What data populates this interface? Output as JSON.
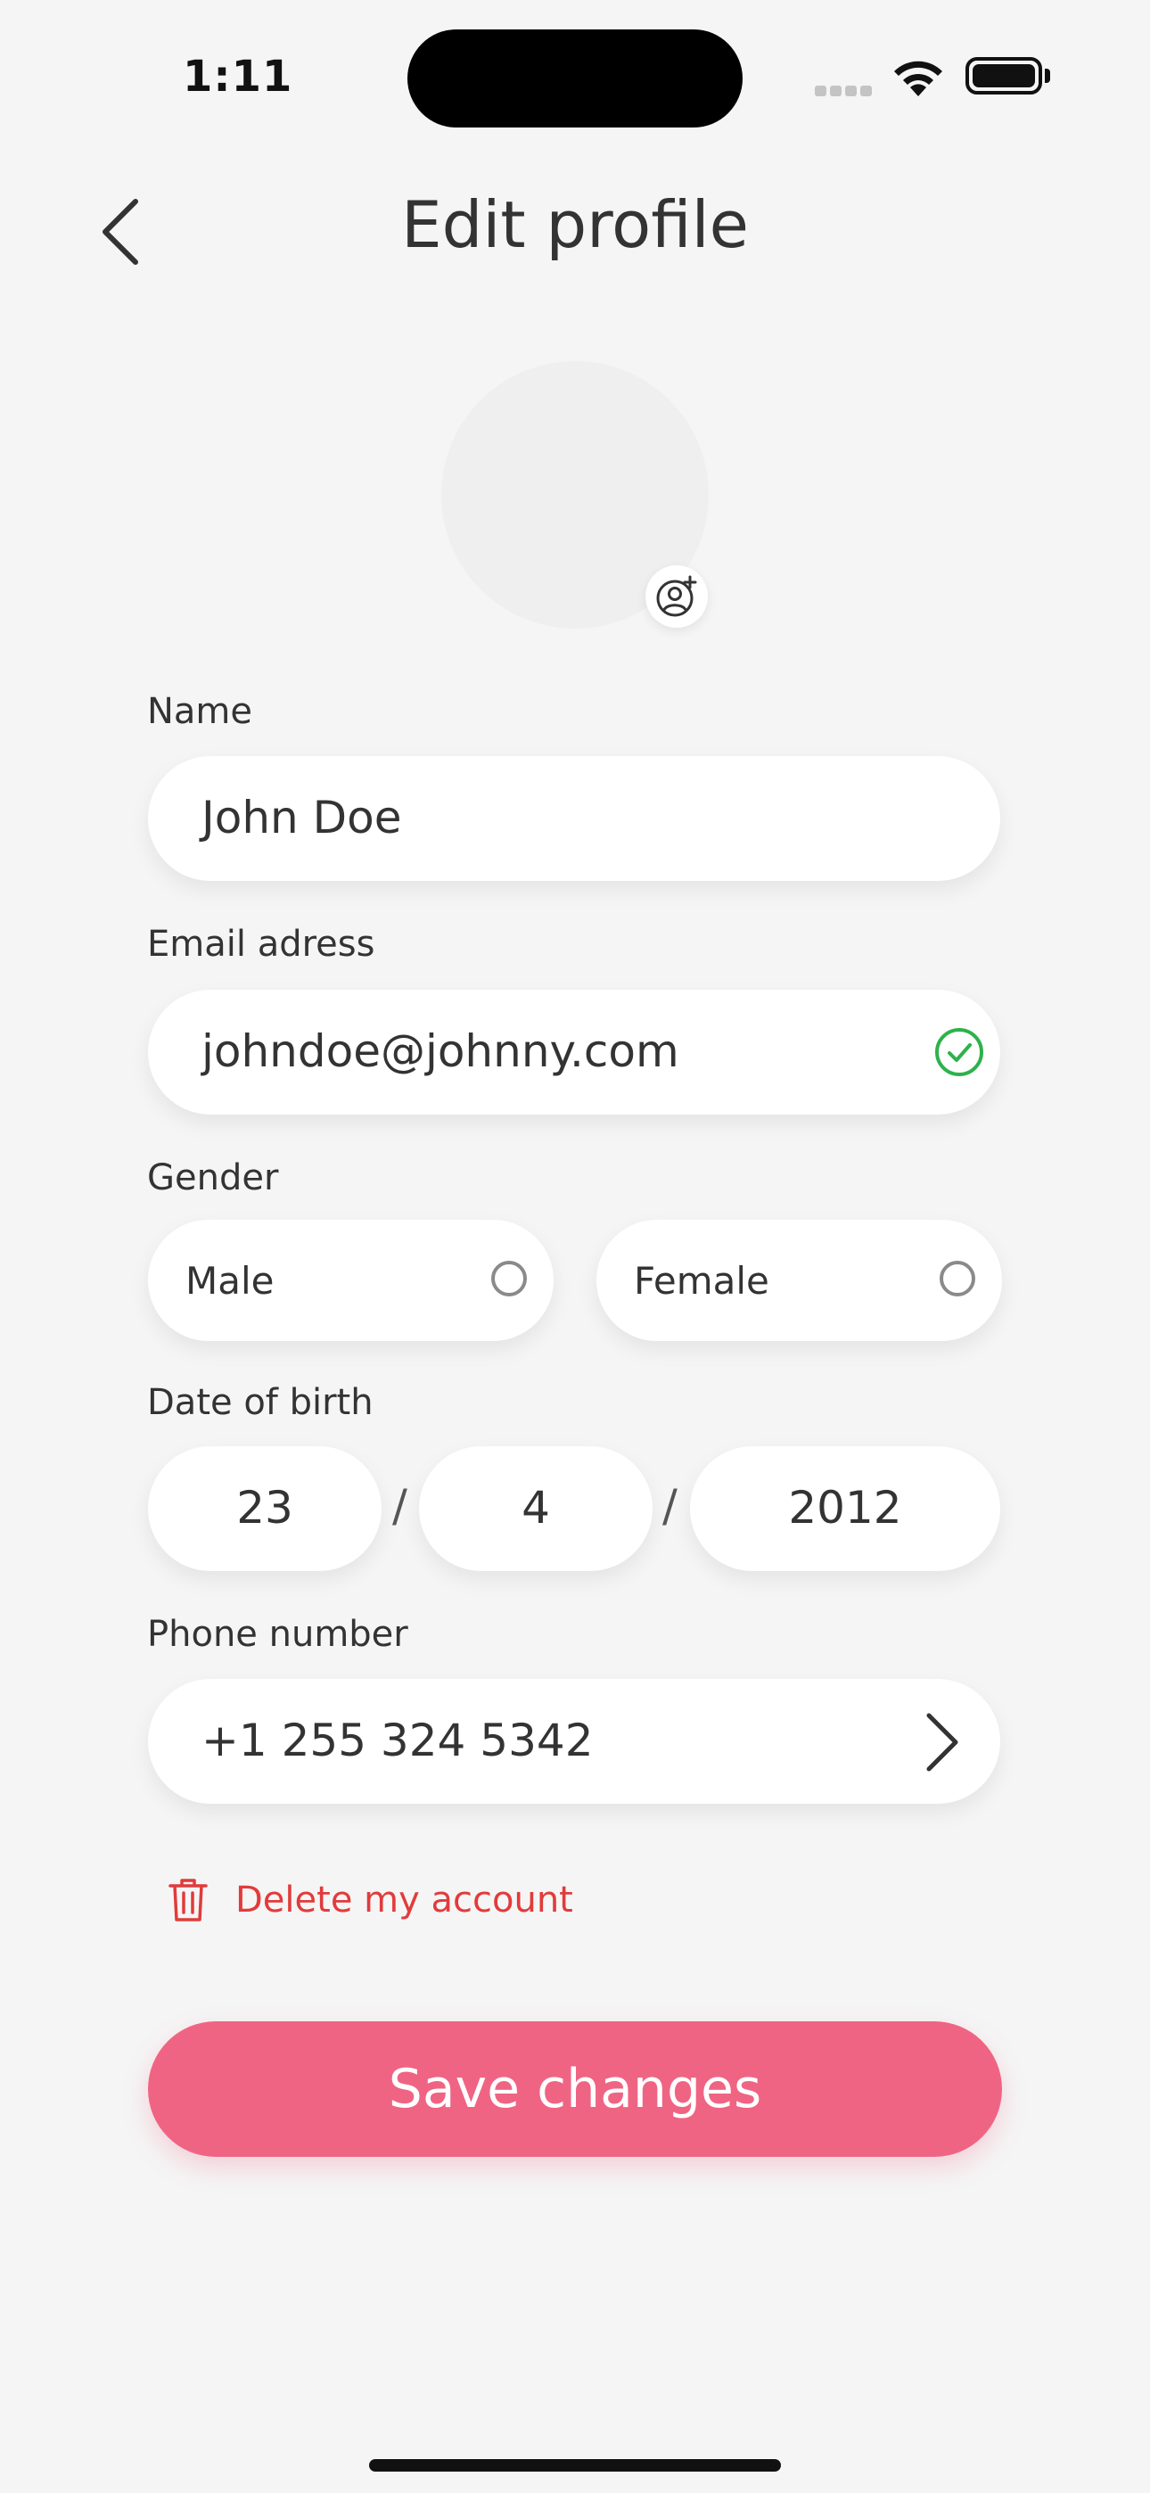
{
  "status_bar": {
    "time": "1:11"
  },
  "header": {
    "title": "Edit profile"
  },
  "form": {
    "name": {
      "label": "Name",
      "value": "John Doe"
    },
    "email": {
      "label": "Email adress",
      "value": "johndoe@johnny.com",
      "valid": true
    },
    "gender": {
      "label": "Gender",
      "options": [
        "Male",
        "Female"
      ],
      "selected": null
    },
    "dob": {
      "label": "Date of birth",
      "day": "23",
      "month": "4",
      "year": "2012",
      "separator": "/"
    },
    "phone": {
      "label": "Phone number",
      "value": "+1 255 324 5342"
    }
  },
  "actions": {
    "delete_label": "Delete my account",
    "save_label": "Save changes"
  },
  "colors": {
    "accent": "#f06483",
    "danger": "#e23b3b",
    "success": "#2db24a",
    "background": "#f5f5f5"
  },
  "icons": [
    "back-chevron-icon",
    "add-photo-icon",
    "check-circle-icon",
    "radio-icon",
    "chevron-right-icon",
    "trash-icon",
    "wifi-icon",
    "battery-icon"
  ]
}
